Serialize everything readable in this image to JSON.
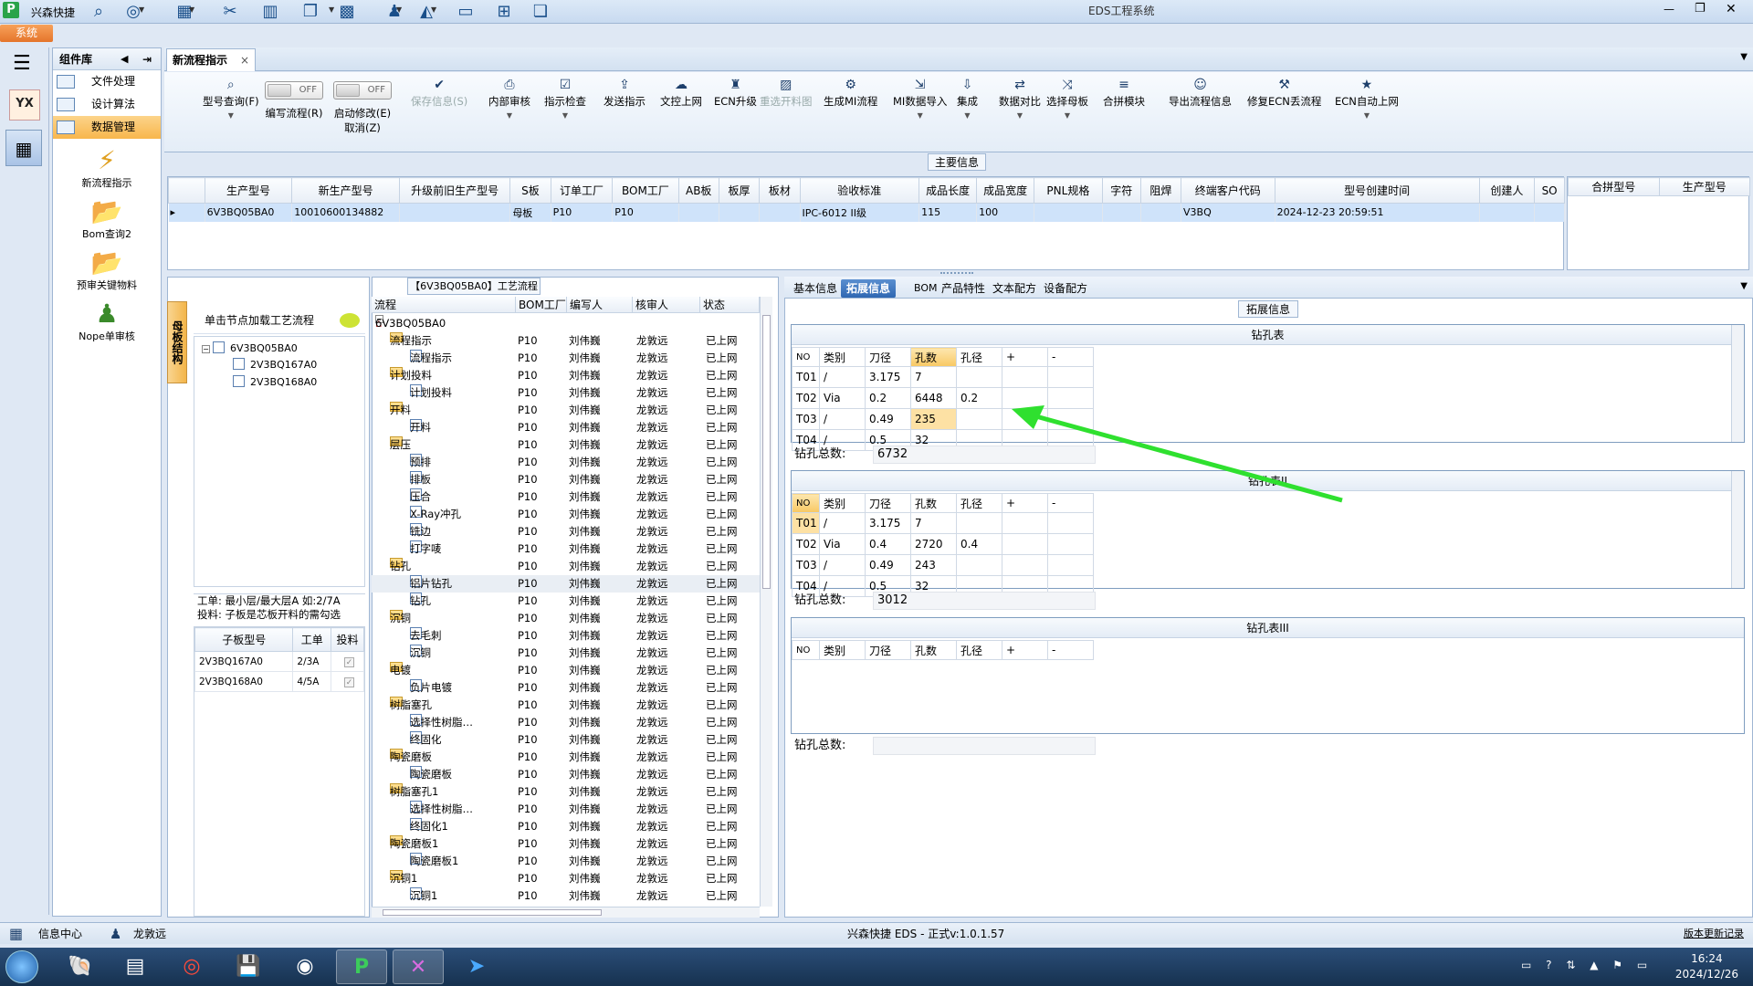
{
  "window": {
    "app_name": "兴森快捷",
    "title": "EDS工程系统",
    "sys_tab": "系统"
  },
  "toolbar_icons": [
    "search-icon",
    "lifebuoy-icon",
    "table-icon",
    "scissors-icon",
    "film-icon",
    "copy-icon",
    "grid-icon",
    "user-icon",
    "chart-icon",
    "monitor-icon",
    "windows-icon",
    "window-icon"
  ],
  "left_panel": {
    "title": "组件库",
    "items": [
      "文件处理",
      "设计算法",
      "数据管理"
    ],
    "big_items": [
      "新流程指示",
      "Bom查询2",
      "预审关键物料",
      "Nope单审核"
    ]
  },
  "doc_tab": {
    "label": "新流程指示"
  },
  "ribbon": {
    "items": [
      {
        "label": "型号查询(F)",
        "icon": "search-icon"
      },
      {
        "label": "编写流程(R)",
        "toggle": "OFF"
      },
      {
        "label": "启动修改(E)",
        "label2": "取消(Z)",
        "toggle": "OFF"
      },
      {
        "label": "保存信息(S)",
        "icon": "check-icon",
        "disabled": true
      },
      {
        "label": "内部审核",
        "icon": "print-icon"
      },
      {
        "label": "指示检查",
        "icon": "clipboard-icon"
      },
      {
        "label": "发送指示",
        "icon": "upload-icon"
      },
      {
        "label": "文控上网",
        "icon": "cloud-icon"
      },
      {
        "label": "ECN升级",
        "icon": "people-icon"
      },
      {
        "label": "重选开料图",
        "icon": "image-icon",
        "disabled": true
      },
      {
        "label": "生成MI流程",
        "icon": "gears-icon"
      },
      {
        "label": "MI数据导入",
        "icon": "import-icon"
      },
      {
        "label": "集成",
        "icon": "download-icon"
      },
      {
        "label": "数据对比",
        "icon": "compare-icon"
      },
      {
        "label": "选择母板",
        "icon": "shuffle-icon"
      },
      {
        "label": "合拼模块",
        "icon": "list-icon"
      },
      {
        "label": "导出流程信息",
        "icon": "smile-icon"
      },
      {
        "label": "修复ECN丢流程",
        "icon": "wrench-icon"
      },
      {
        "label": "ECN自动上网",
        "icon": "star-icon"
      }
    ]
  },
  "main_info": {
    "title": "主要信息",
    "columns": [
      "生产型号",
      "新生产型号",
      "升级前旧生产型号",
      "S板",
      "订单工厂",
      "BOM工厂",
      "AB板",
      "板厚",
      "板材",
      "验收标准",
      "成品长度",
      "成品宽度",
      "PNL规格",
      "字符",
      "阻焊",
      "终端客户代码",
      "型号创建时间",
      "创建人",
      "SO"
    ],
    "rows": [
      [
        "6V3BQ05BA0",
        "10010600134882",
        "",
        "母板",
        "P10",
        "P10",
        "",
        "",
        "",
        "IPC-6012 II级",
        "115",
        "100",
        "",
        "",
        "",
        "V3BQ",
        "2024-12-23 20:59:51",
        "",
        ""
      ]
    ],
    "side_columns": [
      "合拼型号",
      "生产型号"
    ]
  },
  "structure": {
    "vertical_label": "母板结构",
    "load_hint": "单击节点加载工艺流程",
    "tree": {
      "root": "6V3BQ05BA0",
      "children": [
        "2V3BQ167A0",
        "2V3BQ168A0"
      ]
    },
    "work_info_1": "工单: 最小层/最大层A 如:2/7A",
    "work_info_2": "投料: 子板是芯板开料的需勾选",
    "sub_columns": [
      "子板型号",
      "工单",
      "投料"
    ],
    "sub_rows": [
      {
        "model": "2V3BQ167A0",
        "work": "2/3A",
        "checked": "✓"
      },
      {
        "model": "2V3BQ168A0",
        "work": "4/5A",
        "checked": "✓"
      }
    ]
  },
  "process": {
    "title": "【6V3BQ05BA0】工艺流程",
    "columns": [
      "流程",
      "BOM工厂",
      "编写人",
      "核审人",
      "状态"
    ],
    "root": "6V3BQ05BA0",
    "rows": [
      {
        "n": "流程指示",
        "l": 1
      },
      {
        "n": "流程指示",
        "l": 2
      },
      {
        "n": "计划投料",
        "l": 1
      },
      {
        "n": "计划投料",
        "l": 2
      },
      {
        "n": "开料",
        "l": 1
      },
      {
        "n": "开料",
        "l": 2
      },
      {
        "n": "层压",
        "l": 1
      },
      {
        "n": "预排",
        "l": 2
      },
      {
        "n": "排板",
        "l": 2
      },
      {
        "n": "压合",
        "l": 2
      },
      {
        "n": "X-Ray冲孔",
        "l": 2
      },
      {
        "n": "铣边",
        "l": 2
      },
      {
        "n": "打字唛",
        "l": 2
      },
      {
        "n": "钻孔",
        "l": 1
      },
      {
        "n": "铝片钻孔",
        "l": 2
      },
      {
        "n": "钻孔",
        "l": 2
      },
      {
        "n": "沉铜",
        "l": 1
      },
      {
        "n": "去毛刺",
        "l": 2
      },
      {
        "n": "沉铜",
        "l": 2
      },
      {
        "n": "电镀",
        "l": 1
      },
      {
        "n": "负片电镀",
        "l": 2
      },
      {
        "n": "树脂塞孔",
        "l": 1
      },
      {
        "n": "选择性树脂…",
        "l": 2
      },
      {
        "n": "终固化",
        "l": 2
      },
      {
        "n": "陶瓷磨板",
        "l": 1
      },
      {
        "n": "陶瓷磨板",
        "l": 2
      },
      {
        "n": "树脂塞孔1",
        "l": 1
      },
      {
        "n": "选择性树脂…",
        "l": 2
      },
      {
        "n": "终固化1",
        "l": 2
      },
      {
        "n": "陶瓷磨板1",
        "l": 1
      },
      {
        "n": "陶瓷磨板1",
        "l": 2
      },
      {
        "n": "沉铜1",
        "l": 1
      },
      {
        "n": "沉铜1",
        "l": 2
      }
    ],
    "bom": "P10",
    "writer": "刘伟巍",
    "reviewer": "龙敦远",
    "status": "已上网"
  },
  "right": {
    "tabs": [
      "基本信息",
      "拓展信息",
      "BOM",
      "产品特性",
      "文本配方",
      "设备配方"
    ],
    "group_title": "拓展信息",
    "columns": [
      "NO",
      "类别",
      "刀径",
      "孔数",
      "孔径",
      "+",
      "-"
    ],
    "total_label": "钻孔总数:",
    "tables": [
      {
        "title": "钻孔表",
        "total": "6732",
        "rows": [
          [
            "T01",
            "/",
            "3.175",
            "7",
            ""
          ],
          [
            "T02",
            "Via",
            "0.2",
            "6448",
            "0.2"
          ],
          [
            "T03",
            "/",
            "0.49",
            "235",
            ""
          ],
          [
            "T04",
            "/",
            "0.5",
            "32",
            ""
          ]
        ]
      },
      {
        "title": "钻孔表II",
        "total": "3012",
        "rows": [
          [
            "T01",
            "/",
            "3.175",
            "7",
            ""
          ],
          [
            "T02",
            "Via",
            "0.4",
            "2720",
            "0.4"
          ],
          [
            "T03",
            "/",
            "0.49",
            "243",
            ""
          ],
          [
            "T04",
            "/",
            "0.5",
            "32",
            ""
          ]
        ]
      },
      {
        "title": "钻孔表III",
        "total": "",
        "rows": []
      }
    ]
  },
  "status": {
    "info": "信息中心",
    "user": "龙敦远",
    "version": "兴森快捷 EDS - 正式v:1.0.1.57",
    "update": "版本更新记录"
  },
  "taskbar": {
    "time": "16:24",
    "date": "2024/12/26"
  },
  "colors": {
    "accent": "#2f67b2",
    "highlight": "#f8c863",
    "arrow": "#2fe02f"
  }
}
